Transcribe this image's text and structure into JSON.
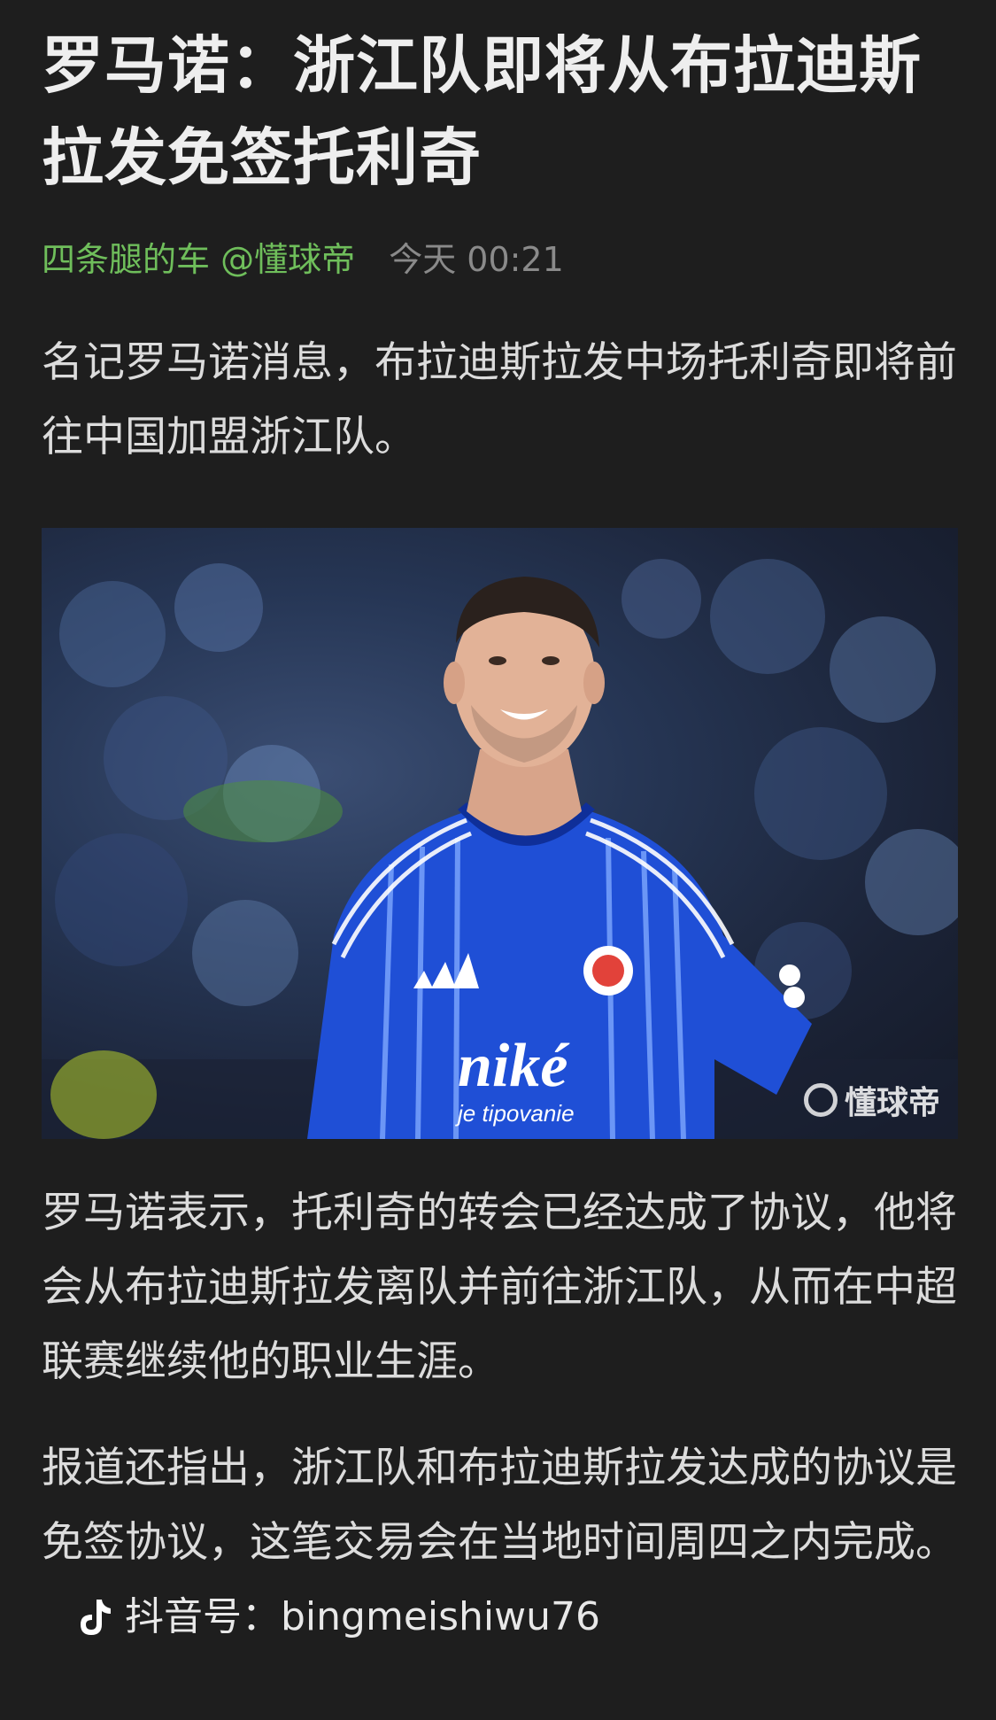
{
  "article": {
    "title": "罗马诺：浙江队即将从布拉迪斯拉发免签托利奇",
    "author": "四条腿的车 @懂球帝",
    "time": "今天 00:21",
    "paragraph_1": "名记罗马诺消息，布拉迪斯拉发中场托利奇即将前往中国加盟浙江队。",
    "image": {
      "jersey_sponsor": "niké",
      "jersey_sponsor_sub": "je tipovanie",
      "watermark": "懂球帝"
    },
    "paragraph_2": "罗马诺表示，托利奇的转会已经达成了协议，他将会从布拉迪斯拉发离队并前往浙江队，从而在中超联赛继续他的职业生涯。",
    "paragraph_3": "报道还指出，浙江队和布拉迪斯拉发达成的协议是免签协议，这笔交易会在当地时间周四之内完成。",
    "douyin_label": "抖音号：bingmeishiwu76"
  },
  "icons": {
    "douyin": "tiktok-icon",
    "watermark": "dongqiudi-logo-icon"
  },
  "colors": {
    "background": "#1e1e1e",
    "author": "#6fbe5b",
    "time": "#8a8a8a",
    "text": "#dcdcdc",
    "jersey": "#1f4fd6"
  }
}
